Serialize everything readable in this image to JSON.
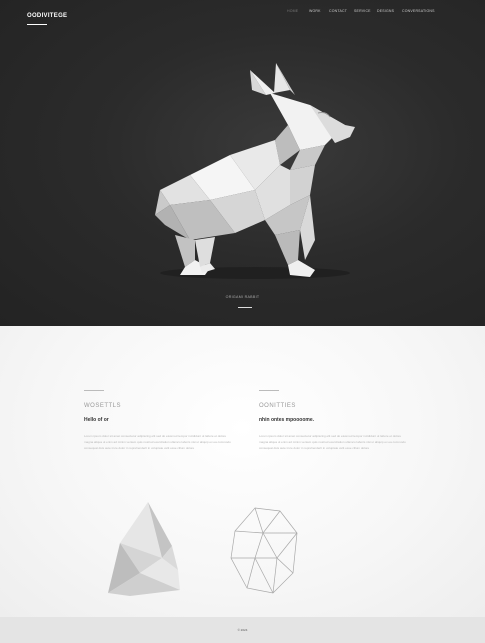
{
  "header": {
    "logo": "OODIVITEGE",
    "nav": [
      {
        "label": "HOME",
        "active": true
      },
      {
        "label": "WORK",
        "active": false
      },
      {
        "label": "CONTACT",
        "active": false
      },
      {
        "label": "SERVICE",
        "active": false
      },
      {
        "label": "DESIGNS",
        "active": false
      },
      {
        "label": "CONVERSATIONS",
        "active": false
      }
    ]
  },
  "hero": {
    "caption": "ORIGAMI RABBIT"
  },
  "columns": [
    {
      "label": "WOSETTLS",
      "heading": "Hello of or",
      "text": "Lorem ipsum dolor sit amet consectetur adipiscing elit sed do eiusmod tempor incididunt ut labore et dolore magna aliqua ut enim ad minim veniam quis nostrud exercitation ullamco laboris nisi ut aliquip ex ea commodo consequat duis aute irure dolor in reprehenderit in voluptate velit esse cillum dolore"
    },
    {
      "label": "OONITTIES",
      "heading": "nhin ontes mpoooome.",
      "text": "Lorem ipsum dolor sit amet consectetur adipiscing elit sed do eiusmod tempor incididunt ut labore et dolore magna aliqua ut enim ad minim veniam quis nostrud exercitation ullamco laboris nisi ut aliquip ex ea commodo consequat duis aute irure dolor in reprehenderit in voluptate velit esse cillum dolore"
    }
  ],
  "footer": {
    "text": "© 2024"
  },
  "colors": {
    "hero_bg": "#2b2b2b",
    "content_bg": "#f7f7f7",
    "footer_bg": "#e4e4e4",
    "accent": "#ffffff"
  }
}
